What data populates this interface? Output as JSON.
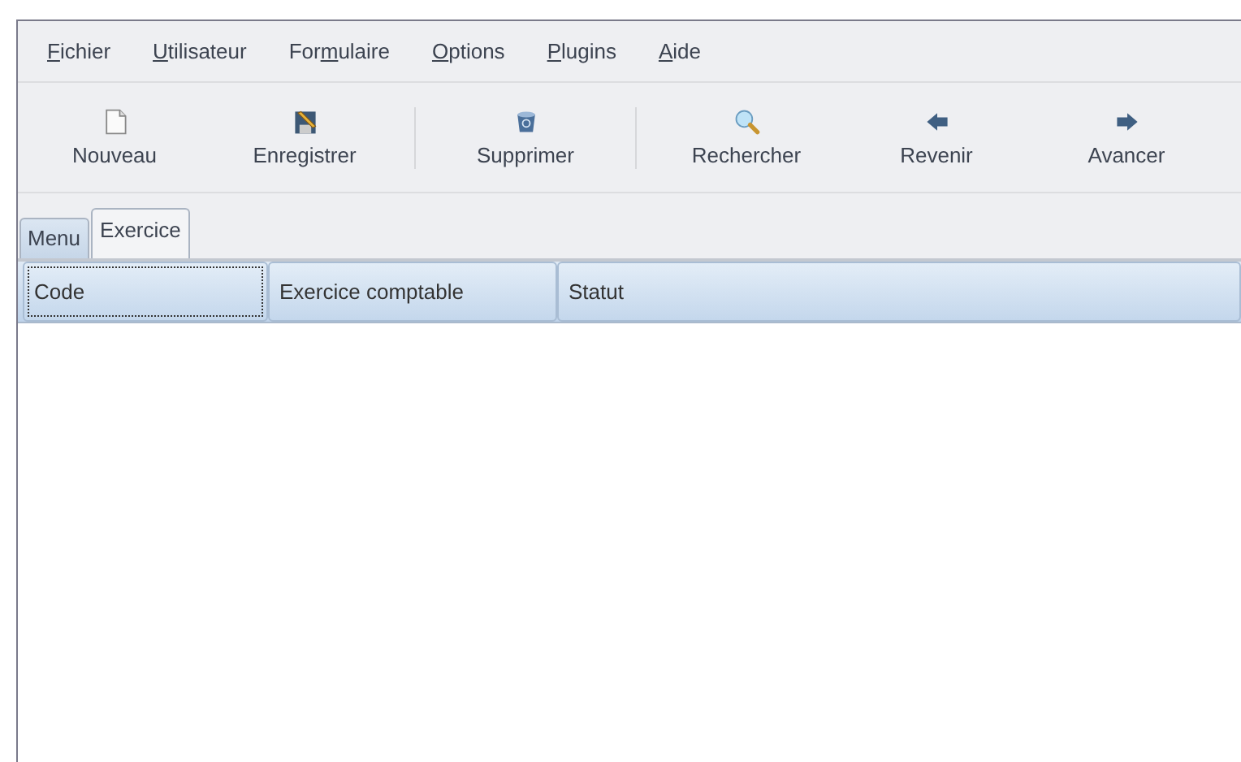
{
  "menu_bar": [
    {
      "mnemonic": "F",
      "label_end": "ichier"
    },
    {
      "mnemonic": "U",
      "label_end": "tilisateur"
    },
    {
      "label_start": "For",
      "mnemonic": "m",
      "label_end": "ulaire"
    },
    {
      "mnemonic": "O",
      "label_end": "ptions"
    },
    {
      "mnemonic": "P",
      "label_end": "lugins"
    },
    {
      "mnemonic": "A",
      "label_end": "ide"
    }
  ],
  "toolbar": [
    {
      "label": "Nouveau",
      "kind": "new",
      "separator_after": false
    },
    {
      "label": "Enregistrer",
      "kind": "save",
      "separator_after": true
    },
    {
      "label": "Supprimer",
      "kind": "delete",
      "separator_after": true
    },
    {
      "label": "Rechercher",
      "kind": "search",
      "separator_after": false
    },
    {
      "label": "Revenir",
      "kind": "back",
      "separator_after": false
    },
    {
      "label": "Avancer",
      "kind": "forward",
      "separator_after": false
    }
  ],
  "tabs": [
    {
      "label": "Menu",
      "selected": false
    },
    {
      "label": "Exercice",
      "selected": true
    }
  ],
  "table": {
    "columns": [
      {
        "label": "Code",
        "focused": true
      },
      {
        "label": "Exercice comptable",
        "focused": false
      },
      {
        "label": "Statut",
        "focused": false
      }
    ]
  }
}
